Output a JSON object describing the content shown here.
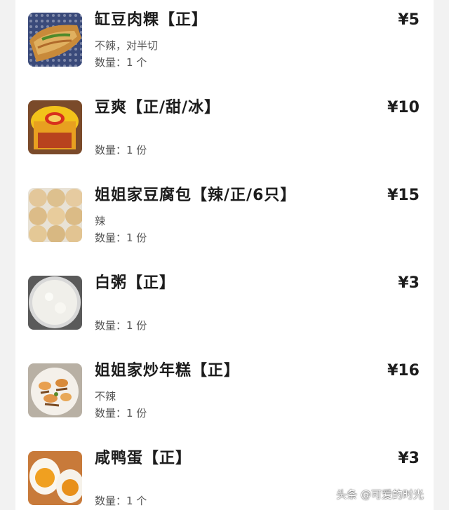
{
  "order": {
    "items": [
      {
        "name": "缸豆肉粿【正】",
        "price": "¥5",
        "note": "不辣，对半切",
        "quantity": "数量：1 个",
        "image_icon": "fried-pancake-image"
      },
      {
        "name": "豆爽【正/甜/冰】",
        "price": "¥10",
        "note": "",
        "quantity": "数量：1 份",
        "image_icon": "dessert-cup-image"
      },
      {
        "name": "姐姐家豆腐包【辣/正/6只】",
        "price": "¥15",
        "note": "辣",
        "quantity": "数量：1 份",
        "image_icon": "tofu-buns-image"
      },
      {
        "name": "白粥【正】",
        "price": "¥3",
        "note": "",
        "quantity": "数量：1 份",
        "image_icon": "congee-bowl-image"
      },
      {
        "name": "姐姐家炒年糕【正】",
        "price": "¥16",
        "note": "不辣",
        "quantity": "数量：1 份",
        "image_icon": "fried-rice-cake-image"
      },
      {
        "name": "咸鸭蛋【正】",
        "price": "¥3",
        "note": "",
        "quantity": "数量：1 个",
        "image_icon": "salted-egg-image"
      }
    ]
  },
  "watermark": "头条 @可爱的时光",
  "colors": {
    "background": "#f2f2f2",
    "card": "#ffffff",
    "text_primary": "#1c1c1c",
    "text_secondary": "#555555"
  }
}
